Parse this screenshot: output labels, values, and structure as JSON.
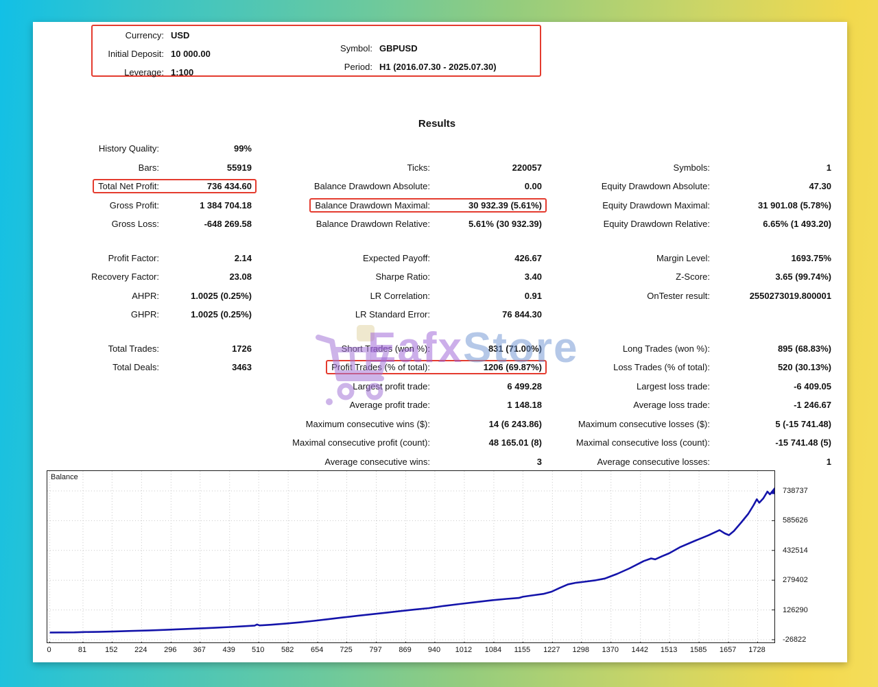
{
  "header": {
    "left_rows": [
      {
        "label": "Currency:",
        "value": "USD"
      },
      {
        "label": "Initial Deposit:",
        "value": "10 000.00"
      },
      {
        "label": "Leverage:",
        "value": "1:100"
      }
    ],
    "right_rows": [
      {
        "label": "Symbol:",
        "value": "GBPUSD"
      },
      {
        "label": "Period:",
        "value": "H1 (2016.07.30 - 2025.07.30)"
      }
    ]
  },
  "results_title": "Results",
  "accent": {
    "highlight_box_color": "#e43b2e",
    "curve_color": "#1414aa"
  },
  "watermark": {
    "icon": "shopping-cart-icon",
    "text_primary": "Eafx",
    "text_secondary": "Store"
  },
  "stats_blocks": [
    {
      "rows": [
        [
          {
            "l": "History Quality:",
            "v": "99%"
          },
          null,
          null
        ],
        [
          {
            "l": "Bars:",
            "v": "55919"
          },
          {
            "l": "Ticks:",
            "v": "220057"
          },
          {
            "l": "Symbols:",
            "v": "1"
          }
        ],
        [
          {
            "l": "Total Net Profit:",
            "v": "736 434.60",
            "box": true
          },
          {
            "l": "Balance Drawdown Absolute:",
            "v": "0.00"
          },
          {
            "l": "Equity Drawdown Absolute:",
            "v": "47.30"
          }
        ],
        [
          {
            "l": "Gross Profit:",
            "v": "1 384 704.18"
          },
          {
            "l": "Balance Drawdown Maximal:",
            "v": "30 932.39 (5.61%)",
            "box": true
          },
          {
            "l": "Equity Drawdown Maximal:",
            "v": "31 901.08 (5.78%)"
          }
        ],
        [
          {
            "l": "Gross Loss:",
            "v": "-648 269.58"
          },
          {
            "l": "Balance Drawdown Relative:",
            "v": "5.61% (30 932.39)"
          },
          {
            "l": "Equity Drawdown Relative:",
            "v": "6.65% (1 493.20)"
          }
        ]
      ]
    },
    {
      "rows": [
        [
          {
            "l": "Profit Factor:",
            "v": "2.14"
          },
          {
            "l": "Expected Payoff:",
            "v": "426.67"
          },
          {
            "l": "Margin Level:",
            "v": "1693.75%"
          }
        ],
        [
          {
            "l": "Recovery Factor:",
            "v": "23.08"
          },
          {
            "l": "Sharpe Ratio:",
            "v": "3.40"
          },
          {
            "l": "Z-Score:",
            "v": "3.65 (99.74%)"
          }
        ],
        [
          {
            "l": "AHPR:",
            "v": "1.0025 (0.25%)"
          },
          {
            "l": "LR Correlation:",
            "v": "0.91"
          },
          {
            "l": "OnTester result:",
            "v": "2550273019.800001"
          }
        ],
        [
          {
            "l": "GHPR:",
            "v": "1.0025 (0.25%)"
          },
          {
            "l": "LR Standard Error:",
            "v": "76 844.30"
          },
          null
        ]
      ]
    },
    {
      "rows": [
        [
          {
            "l": "Total Trades:",
            "v": "1726"
          },
          {
            "l": "Short Trades (won %):",
            "v": "831 (71.00%)"
          },
          {
            "l": "Long Trades (won %):",
            "v": "895 (68.83%)"
          }
        ],
        [
          {
            "l": "Total Deals:",
            "v": "3463"
          },
          {
            "l": "Profit Trades (% of total):",
            "v": "1206 (69.87%)",
            "box": true
          },
          {
            "l": "Loss Trades (% of total):",
            "v": "520 (30.13%)"
          }
        ],
        [
          null,
          {
            "l": "Largest profit trade:",
            "v": "6 499.28"
          },
          {
            "l": "Largest loss trade:",
            "v": "-6 409.05"
          }
        ],
        [
          null,
          {
            "l": "Average profit trade:",
            "v": "1 148.18"
          },
          {
            "l": "Average loss trade:",
            "v": "-1 246.67"
          }
        ],
        [
          null,
          {
            "l": "Maximum consecutive wins ($):",
            "v": "14 (6 243.86)"
          },
          {
            "l": "Maximum consecutive losses ($):",
            "v": "5 (-15 741.48)"
          }
        ],
        [
          null,
          {
            "l": "Maximal consecutive profit (count):",
            "v": "48 165.01 (8)"
          },
          {
            "l": "Maximal consecutive loss (count):",
            "v": "-15 741.48 (5)"
          }
        ],
        [
          null,
          {
            "l": "Average consecutive wins:",
            "v": "3"
          },
          {
            "l": "Average consecutive losses:",
            "v": "1"
          }
        ]
      ]
    }
  ],
  "chart_data": {
    "type": "line",
    "title": "Balance",
    "legend_position": "top-left-inside",
    "grid": "dotted",
    "x_ticks": [
      0,
      81,
      152,
      224,
      296,
      367,
      439,
      510,
      582,
      654,
      725,
      797,
      869,
      940,
      1012,
      1084,
      1155,
      1227,
      1298,
      1370,
      1442,
      1513,
      1585,
      1657,
      1728
    ],
    "y_ticks": [
      -26822,
      126290,
      279402,
      432514,
      585626,
      738737
    ],
    "x_range": [
      -6,
      1769
    ],
    "y_range": [
      -40900,
      841000
    ],
    "series": [
      {
        "name": "Balance",
        "points": [
          [
            0,
            10000
          ],
          [
            30,
            10700
          ],
          [
            60,
            11000
          ],
          [
            85,
            12800
          ],
          [
            120,
            13600
          ],
          [
            160,
            15800
          ],
          [
            200,
            18200
          ],
          [
            240,
            20600
          ],
          [
            280,
            23800
          ],
          [
            320,
            27200
          ],
          [
            360,
            30800
          ],
          [
            400,
            34400
          ],
          [
            440,
            38400
          ],
          [
            475,
            42800
          ],
          [
            500,
            46000
          ],
          [
            506,
            51500
          ],
          [
            512,
            46500
          ],
          [
            540,
            50000
          ],
          [
            575,
            55800
          ],
          [
            610,
            62600
          ],
          [
            645,
            70300
          ],
          [
            680,
            78800
          ],
          [
            715,
            87400
          ],
          [
            750,
            96000
          ],
          [
            785,
            104200
          ],
          [
            820,
            112000
          ],
          [
            855,
            120200
          ],
          [
            890,
            128000
          ],
          [
            925,
            135600
          ],
          [
            960,
            146500
          ],
          [
            1000,
            156500
          ],
          [
            1040,
            166500
          ],
          [
            1080,
            176500
          ],
          [
            1115,
            183000
          ],
          [
            1145,
            188000
          ],
          [
            1155,
            194000
          ],
          [
            1175,
            200500
          ],
          [
            1205,
            209000
          ],
          [
            1225,
            220000
          ],
          [
            1245,
            240000
          ],
          [
            1265,
            258000
          ],
          [
            1285,
            266500
          ],
          [
            1305,
            271300
          ],
          [
            1330,
            278000
          ],
          [
            1355,
            288000
          ],
          [
            1385,
            312000
          ],
          [
            1415,
            340000
          ],
          [
            1450,
            378000
          ],
          [
            1468,
            391300
          ],
          [
            1478,
            386500
          ],
          [
            1495,
            403000
          ],
          [
            1512,
            417700
          ],
          [
            1538,
            448600
          ],
          [
            1572,
            479500
          ],
          [
            1608,
            510300
          ],
          [
            1635,
            536800
          ],
          [
            1648,
            520000
          ],
          [
            1658,
            511000
          ],
          [
            1670,
            532400
          ],
          [
            1688,
            576500
          ],
          [
            1705,
            620600
          ],
          [
            1718,
            664700
          ],
          [
            1726,
            695500
          ],
          [
            1732,
            678000
          ],
          [
            1742,
            701000
          ],
          [
            1752,
            735300
          ],
          [
            1758,
            721000
          ],
          [
            1765,
            738737
          ]
        ]
      }
    ]
  }
}
